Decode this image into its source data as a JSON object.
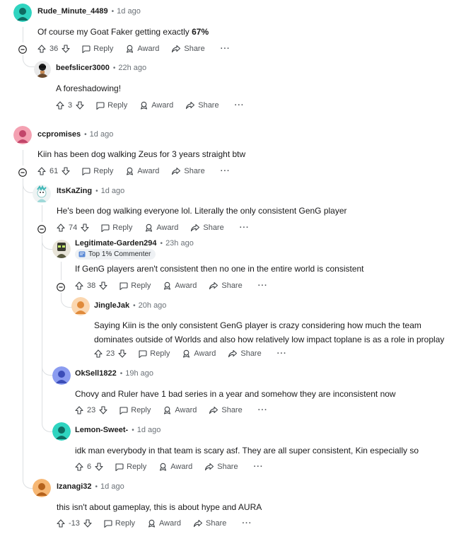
{
  "labels": {
    "reply": "Reply",
    "award": "Award",
    "share": "Share",
    "more": "···",
    "separator": "•"
  },
  "comments": [
    {
      "author": "Rude_Minute_4489",
      "time": "1d ago",
      "text_pre": "Of course my Goat Faker getting exactly ",
      "text_bold": "67%",
      "votes": "36",
      "avatar_color": "#2fd4c0"
    },
    {
      "author": "beefslicer3000",
      "time": "22h ago",
      "text": "A foreshadowing!",
      "votes": "3",
      "avatar_color": "#6b4a2e"
    },
    {
      "author": "ccpromises",
      "time": "1d ago",
      "text": "Kiin has been dog walking Zeus for 3 years straight btw",
      "votes": "61",
      "avatar_color": "#f4a1b2"
    },
    {
      "author": "ItsKaZing",
      "time": "1d ago",
      "text": "He's been dog walking everyone lol. Literally the only consistent GenG player",
      "votes": "74",
      "avatar_color": "#9fd9d9"
    },
    {
      "author": "Legitimate-Garden294",
      "time": "23h ago",
      "flair": "Top 1% Commenter",
      "text": "If GenG players aren't consistent then no one in the entire world is consistent",
      "votes": "38",
      "avatar_color": "#3a3a30"
    },
    {
      "author": "JingleJak",
      "time": "20h ago",
      "text_lines": [
        "Saying Kiin is the only consistent GenG player is crazy considering how much the team",
        "dominates outside of Worlds and also how relatively low impact toplane is as a role in proplay"
      ],
      "votes": "23",
      "avatar_color": "#f2a65a"
    },
    {
      "author": "OkSell1822",
      "time": "19h ago",
      "text": "Chovy and Ruler have 1 bad series in a year and somehow they are inconsistent now",
      "votes": "23",
      "avatar_color": "#8b9cf0"
    },
    {
      "author": "Lemon-Sweet-",
      "time": "1d ago",
      "text": "idk man everybody in that team is scary asf. They are all super consistent, Kin especially so",
      "votes": "6",
      "avatar_color": "#2fd4c0"
    },
    {
      "author": "Izanagi32",
      "time": "1d ago",
      "text": "this isn't about gameplay, this is about hype and AURA",
      "votes": "-13",
      "avatar_color": "#f2a65a"
    }
  ]
}
